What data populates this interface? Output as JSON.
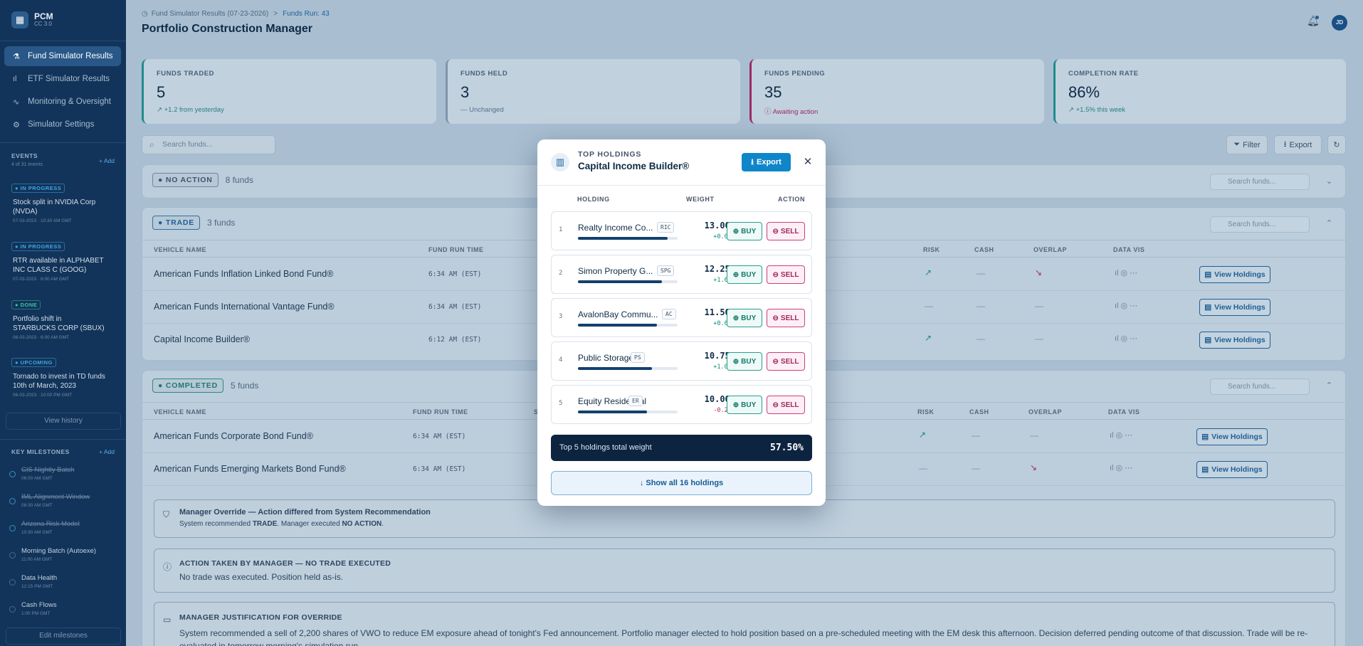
{
  "app": {
    "name": "PCM",
    "version": "CC 3.0",
    "logo_icon": "grid-icon"
  },
  "nav": [
    {
      "label": "Fund Simulator Results",
      "icon": "flask-icon",
      "active": true
    },
    {
      "label": "ETF Simulator Results",
      "icon": "bar-chart-icon",
      "active": false
    },
    {
      "label": "Monitoring & Oversight",
      "icon": "pulse-icon",
      "active": false
    },
    {
      "label": "Simulator Settings",
      "icon": "gear-icon",
      "active": false
    }
  ],
  "events": {
    "heading": "EVENTS",
    "subheading": "4 of 31 events",
    "add_label": "+ Add",
    "items": [
      {
        "status": "● IN PROGRESS",
        "title": "Stock split in NVIDIA Corp (NVDA)",
        "date": "07-03-2023 · 10:30 AM GMT"
      },
      {
        "status": "● IN PROGRESS",
        "title": "RTR available in ALPHABET INC CLASS C (GOOG)",
        "date": "07-03-2023 · 6:00 AM GMT"
      },
      {
        "status": "● DONE",
        "title": "Portfolio shift in STARBUCKS CORP (SBUX)",
        "date": "06-03-2023 · 6:00 AM GMT"
      },
      {
        "status": "● UPCOMING",
        "title": "Tornado to invest in TD funds 10th of March, 2023",
        "date": "06-03-2023 · 10:00 PM GMT"
      }
    ],
    "view_history": "View history"
  },
  "milestones": {
    "heading": "KEY MILESTONES",
    "add_label": "+ Add",
    "items": [
      {
        "title": "CIS Nightly Batch",
        "time": "06:00 AM GMT",
        "done": true
      },
      {
        "title": "IML Alignment Window",
        "time": "08:30 AM GMT",
        "done": true
      },
      {
        "title": "Arizona Risk Model",
        "time": "10:30 AM GMT",
        "done": true
      },
      {
        "title": "Morning Batch (Autoexe)",
        "time": "11:00 AM GMT",
        "done": false
      },
      {
        "title": "Data Health",
        "time": "12:15 PM GMT",
        "done": false
      },
      {
        "title": "Cash Flows",
        "time": "1:00 PM GMT",
        "done": false
      }
    ],
    "edit_label": "Edit milestones"
  },
  "header": {
    "breadcrumb_root": "Fund Simulator Results (07-23-2026)",
    "breadcrumb_sep": ">",
    "breadcrumb_current": "Funds Run: 43",
    "title": "Portfolio Construction Manager",
    "avatar_initials": "JD"
  },
  "stats": [
    {
      "label": "FUNDS TRADED",
      "value": "5",
      "sub": "↗ +1.2 from yesterday",
      "accent": "#1f8c8c"
    },
    {
      "label": "FUNDS HELD",
      "value": "3",
      "sub": "— Unchanged",
      "accent": "#7f95aa"
    },
    {
      "label": "FUNDS PENDING",
      "value": "35",
      "sub": "ⓘ Awaiting action",
      "accent": "#9c2b66"
    },
    {
      "label": "COMPLETION RATE",
      "value": "86%",
      "sub": "↗ +1.5% this week",
      "accent": "#1f8c8c"
    }
  ],
  "toolbar": {
    "search_placeholder": "Search funds...",
    "filter_label": "Filter",
    "export_label": "Export"
  },
  "groups": {
    "no_action": {
      "badge": "● NO ACTION",
      "count": "8 funds",
      "search": "Search funds..."
    },
    "trade": {
      "badge": "● TRADE",
      "count": "3 funds",
      "search": "Search funds...",
      "columns": [
        "VEHICLE NAME",
        "FUND RUN TIME",
        "RISK",
        "CASH",
        "OVERLAP",
        "DATA VIS"
      ],
      "rows": [
        {
          "name": "American Funds Inflation Linked Bond Fund®",
          "time": "6:34 AM (EST)",
          "risk": "↗",
          "cash": "—",
          "overlap": "↘",
          "action": "View Holdings"
        },
        {
          "name": "American Funds International Vantage Fund®",
          "time": "6:34 AM (EST)",
          "risk": "—",
          "cash": "—",
          "overlap": "—",
          "action": "View Holdings"
        },
        {
          "name": "Capital Income Builder®",
          "time": "6:12 AM (EST)",
          "risk": "↗",
          "cash": "—",
          "overlap": "—",
          "action": "View Holdings"
        }
      ]
    },
    "completed": {
      "badge": "● COMPLETED",
      "count": "5 funds",
      "search": "Search funds...",
      "columns": [
        "VEHICLE NAME",
        "FUND RUN TIME",
        "S",
        "RISK",
        "CASH",
        "OVERLAP",
        "DATA VIS"
      ],
      "rows": [
        {
          "name": "American Funds Corporate Bond Fund®",
          "time": "6:34 AM (EST)",
          "risk": "↗",
          "cash": "—",
          "overlap": "—",
          "action": "View Holdings"
        },
        {
          "name": "American Funds Emerging Markets Bond Fund®",
          "time": "6:34 AM (EST)",
          "risk": "—",
          "cash": "—",
          "overlap": "↘",
          "action": "View Holdings"
        }
      ]
    }
  },
  "annotations": {
    "override_title": "Manager Override — Action differed from System Recommendation",
    "override_body_pre": "System recommended ",
    "override_rec": "TRADE",
    "override_body_mid": ". Manager executed ",
    "override_exec": "NO ACTION",
    "override_body_post": ".",
    "action_title": "ACTION TAKEN BY MANAGER — NO TRADE EXECUTED",
    "action_body": "No trade was executed. Position held as-is.",
    "justification_title": "MANAGER JUSTIFICATION FOR OVERRIDE",
    "justification_body": "System recommended a sell of 2,200 shares of VWO to reduce EM exposure ahead of tonight's Fed announcement. Portfolio manager elected to hold position based on a pre-scheduled meeting with the EM desk this afternoon. Decision deferred pending outcome of that discussion. Trade will be re-evaluated in tomorrow morning's simulation run."
  },
  "modal": {
    "label": "TOP HOLDINGS",
    "fund": "Capital Income Builder®",
    "export_label": "Export",
    "columns": {
      "holding": "HOLDING",
      "weight": "WEIGHT",
      "action": "ACTION"
    },
    "buy_label": "BUY",
    "sell_label": "SELL",
    "holdings": [
      {
        "rank": "1",
        "name": "Realty Income Co...",
        "ticker": "RIC",
        "weight": "13.00%",
        "weight_pct": 13.0,
        "delta": "+0.08%",
        "negative": false
      },
      {
        "rank": "2",
        "name": "Simon Property G...",
        "ticker": "SPG",
        "weight": "12.25%",
        "weight_pct": 12.25,
        "delta": "+1.61%",
        "negative": false
      },
      {
        "rank": "3",
        "name": "AvalonBay Commu...",
        "ticker": "AC",
        "weight": "11.50%",
        "weight_pct": 11.5,
        "delta": "+0.67%",
        "negative": false
      },
      {
        "rank": "4",
        "name": "Public Storage",
        "ticker": "PS",
        "weight": "10.75%",
        "weight_pct": 10.75,
        "delta": "+1.02%",
        "negative": false
      },
      {
        "rank": "5",
        "name": "Equity Residential",
        "ticker": "ER",
        "weight": "10.00%",
        "weight_pct": 10.0,
        "delta": "-0.23%",
        "negative": true
      }
    ],
    "total_label": "Top 5 holdings total weight",
    "total_value": "57.50%",
    "show_all": "↓ Show all 16 holdings"
  }
}
